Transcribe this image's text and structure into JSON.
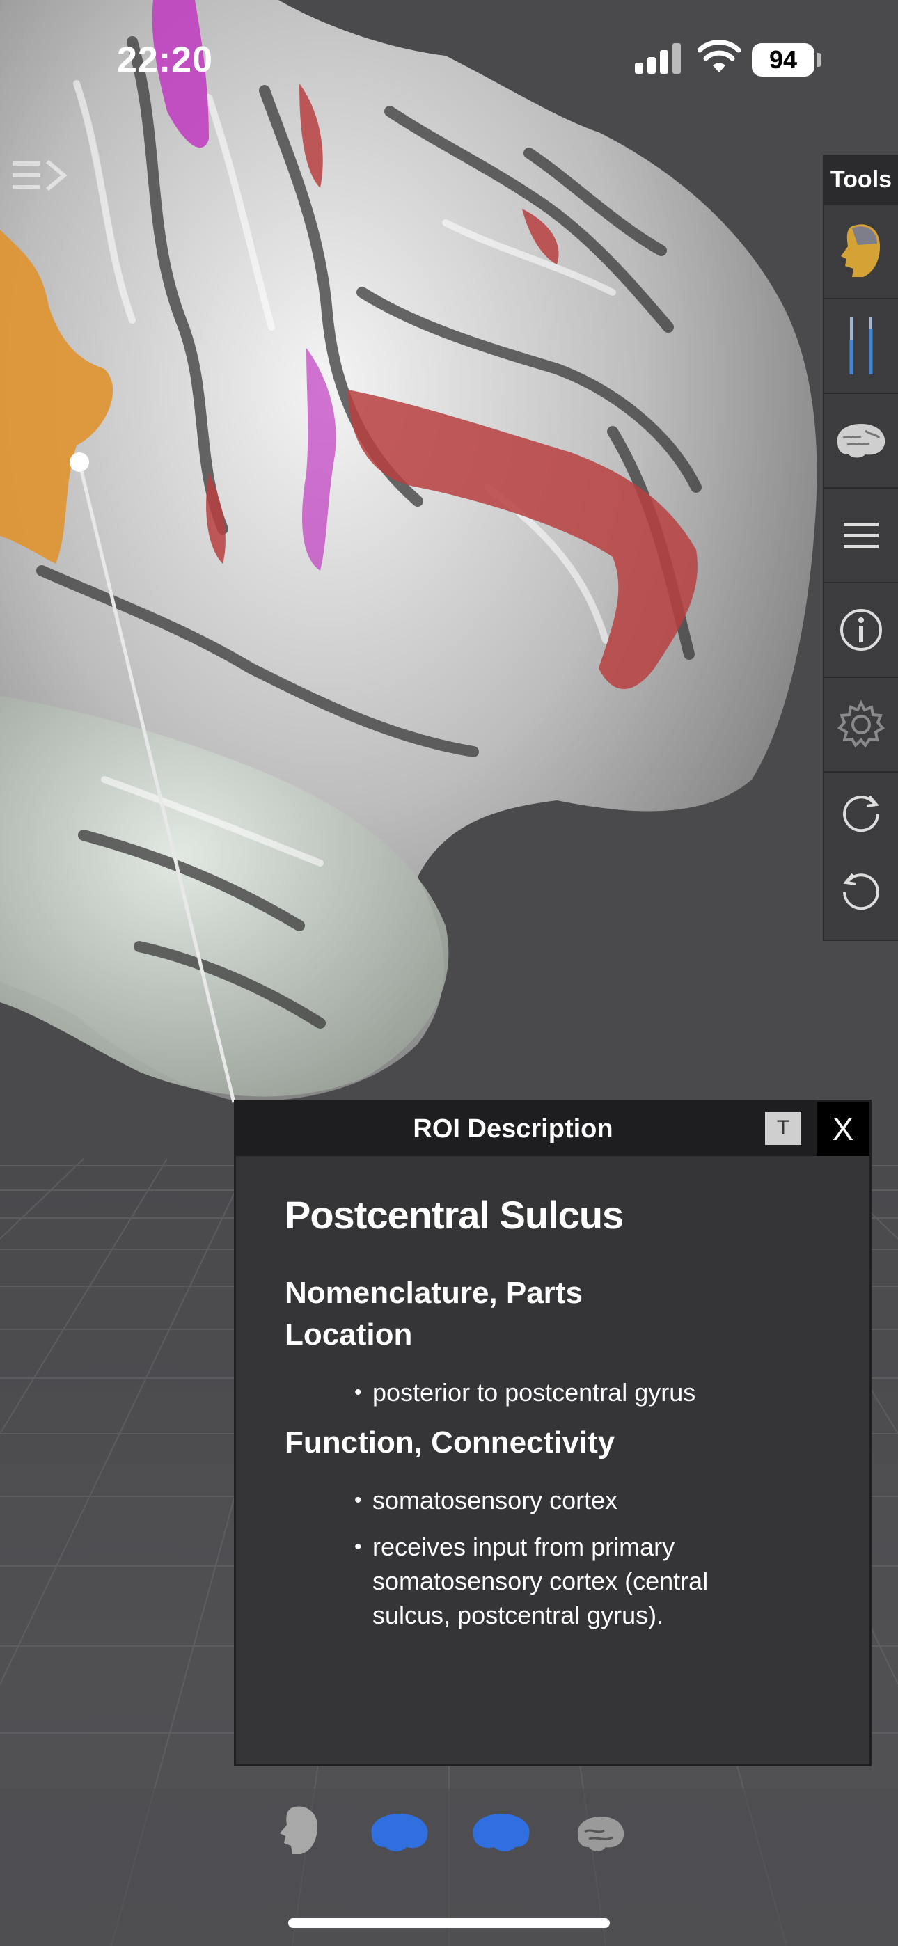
{
  "status_bar": {
    "time": "22:20",
    "battery": "94"
  },
  "tools": {
    "title": "Tools",
    "items": [
      "head-model-icon",
      "sliders-icon",
      "brain-icon",
      "menu-icon",
      "info-icon",
      "settings-gear-icon",
      "rotate-clockwise-icon",
      "rotate-counterclockwise-icon"
    ]
  },
  "roi_panel": {
    "header": "ROI Description",
    "t_button": "T",
    "close_button": "X",
    "title": "Postcentral Sulcus",
    "sections": [
      {
        "heading": "Nomenclature, Parts Location",
        "items": [
          "posterior to postcentral gyrus"
        ]
      },
      {
        "heading": "Function, Connectivity",
        "items": [
          "somatosensory cortex",
          "receives input from primary somatosensory cortex (central sulcus, postcentral gyrus)."
        ]
      }
    ]
  },
  "bottom_bar": [
    "head-view-icon",
    "left-hemisphere-icon",
    "right-hemisphere-icon",
    "brain-section-icon"
  ],
  "colors": {
    "background": "#4a4a4d",
    "roi_highlight_orange": "#e0932f",
    "roi_highlight_red": "#b84040",
    "roi_highlight_magenta": "#c03ac0",
    "hemisphere_blue": "#2f6fe0"
  }
}
